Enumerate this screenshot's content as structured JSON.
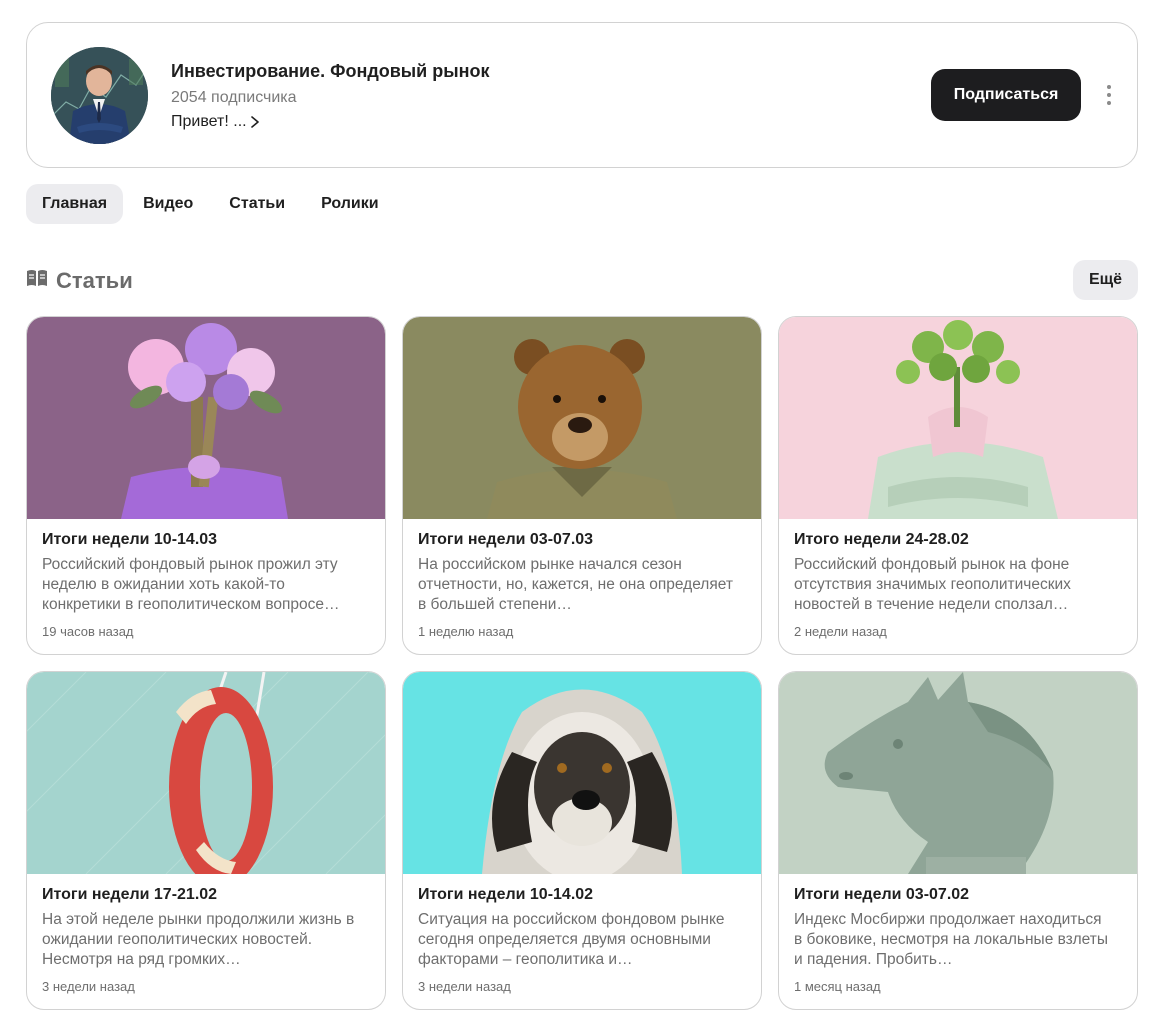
{
  "channel": {
    "title": "Инвестирование. Фондовый рынок",
    "subscribers": "2054 подписчика",
    "description": "Привет! ...",
    "subscribe_label": "Подписаться"
  },
  "tabs": [
    {
      "label": "Главная",
      "active": true
    },
    {
      "label": "Видео",
      "active": false
    },
    {
      "label": "Статьи",
      "active": false
    },
    {
      "label": "Ролики",
      "active": false
    }
  ],
  "section": {
    "title": "Статьи",
    "more_label": "Ещё"
  },
  "articles": [
    {
      "title": "Итоги недели 10-14.03",
      "snippet": "Российский фондовый рынок прожил эту неделю в ожидании хоть какой-то конкретики в геополитическом вопросе…",
      "time": "19 часов назад",
      "image": "flowers-girl",
      "bg": "#8b6388"
    },
    {
      "title": "Итоги недели 03-07.03",
      "snippet": "На российском рынке начался сезон отчетности, но, кажется, не она определяет в большей степени…",
      "time": "1 неделю назад",
      "image": "bear",
      "bg": "#8a8a60"
    },
    {
      "title": "Итого недели 24-28.02",
      "snippet": "Российский фондовый рынок на фоне отсутствия значимых геополитических новостей в течение недели сползал…",
      "time": "2 недели назад",
      "image": "flowers-man",
      "bg": "#f6d3dc"
    },
    {
      "title": "Итоги недели 17-21.02",
      "snippet": "На этой неделе рынки продолжили жизнь в ожидании геополитических новостей.  Несмотря на ряд громких…",
      "time": "3 недели назад",
      "image": "lifebuoy",
      "bg": "#a4d4ce"
    },
    {
      "title": "Итоги недели 10-14.02",
      "snippet": "Ситуация на российском фондовом рынке сегодня определяется двумя основными факторами – геополитика и…",
      "time": "3 недели назад",
      "image": "dog-hoodie",
      "bg": "#66e3e4"
    },
    {
      "title": "Итоги недели 03-07.02",
      "snippet": "Индекс Мосбиржи продолжает находиться в боковике, несмотря на локальные взлеты и падения. Пробить…",
      "time": "1 месяц назад",
      "image": "horse-bust",
      "bg": "#c2d2c4"
    }
  ]
}
